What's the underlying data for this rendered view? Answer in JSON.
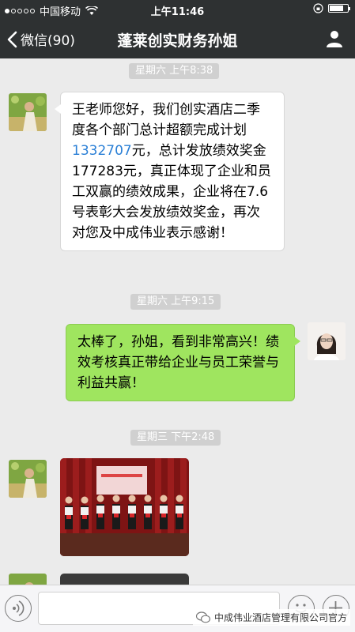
{
  "status_bar": {
    "carrier": "中国移动",
    "time": "上午11:46"
  },
  "nav": {
    "back_label": "微信(90)",
    "title": "蓬莱创实财务孙姐"
  },
  "messages": [
    {
      "type": "timestamp",
      "text": "星期六 上午8:38"
    },
    {
      "type": "incoming_text",
      "pre": "王老师您好，我们创实酒店二季度各个部门总计超额完成计划",
      "number": "1332707",
      "post": "元，总计发放绩效奖金177283元，真正体现了企业和员工双赢的绩效成果，企业将在7.6号表彰大会发放绩效奖金，再次对您及中成伟业表示感谢！"
    },
    {
      "type": "timestamp",
      "text": "星期六 上午9:15"
    },
    {
      "type": "outgoing_text",
      "text": "太棒了，孙姐，看到非常高兴！绩效考核真正带给企业与员工荣誉与利益共赢！"
    },
    {
      "type": "timestamp",
      "text": "星期三 下午2:48"
    },
    {
      "type": "incoming_image"
    }
  ],
  "watermark": {
    "text": "中成伟业酒店管理有限公司官方"
  },
  "colors": {
    "header_bg": "#2e3132",
    "chat_bg": "#ebebeb",
    "outgoing_bubble": "#9fe55f",
    "link_number": "#2a7fd6"
  },
  "icons": {
    "back": "chevron-left-icon",
    "profile": "person-icon",
    "voice": "voice-icon",
    "emoji": "emoji-icon",
    "plus": "plus-icon",
    "wechat": "wechat-icon"
  }
}
